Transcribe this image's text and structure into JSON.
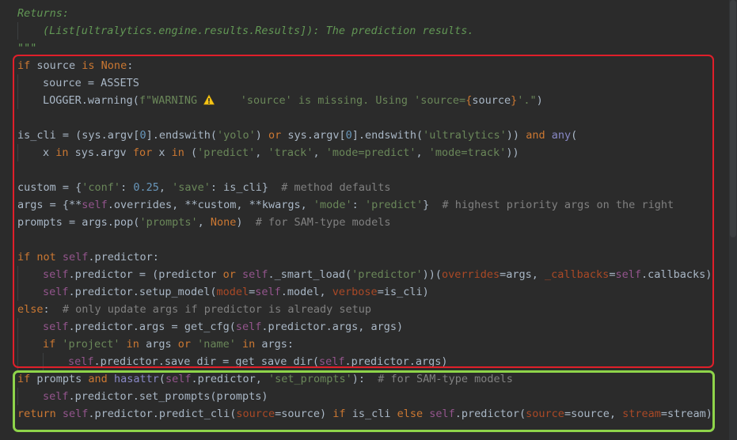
{
  "editor": {
    "lines": [
      {
        "indent": 0,
        "tokens": [
          {
            "t": "Returns:",
            "c": "doc"
          }
        ]
      },
      {
        "indent": 1,
        "tokens": [
          {
            "t": "(List[ultralytics.engine.results.Results]): The prediction results.",
            "c": "doc"
          }
        ]
      },
      {
        "indent": 0,
        "tokens": [
          {
            "t": "\"\"\"",
            "c": "doc"
          }
        ]
      },
      {
        "indent": 0,
        "tokens": [
          {
            "t": "if ",
            "c": "kw"
          },
          {
            "t": "source ",
            "c": "plain"
          },
          {
            "t": "is None",
            "c": "kw"
          },
          {
            "t": ":",
            "c": "plain"
          }
        ]
      },
      {
        "indent": 1,
        "tokens": [
          {
            "t": "source = ASSETS",
            "c": "plain"
          }
        ]
      },
      {
        "indent": 1,
        "tokens": [
          {
            "t": "LOGGER.warning(",
            "c": "plain"
          },
          {
            "t": "f\"WARNING ",
            "c": "str"
          },
          {
            "t": "warning-icon",
            "c": "icon"
          },
          {
            "t": "    'source' is missing. Using 'source=",
            "c": "str"
          },
          {
            "t": "{",
            "c": "kw"
          },
          {
            "t": "source",
            "c": "plain"
          },
          {
            "t": "}",
            "c": "kw"
          },
          {
            "t": "'.\"",
            "c": "str"
          },
          {
            "t": ")",
            "c": "plain"
          }
        ]
      },
      {
        "indent": 0,
        "tokens": []
      },
      {
        "indent": 0,
        "tokens": [
          {
            "t": "is_cli = (sys.argv[",
            "c": "plain"
          },
          {
            "t": "0",
            "c": "num"
          },
          {
            "t": "].endswith(",
            "c": "plain"
          },
          {
            "t": "'yolo'",
            "c": "str"
          },
          {
            "t": ") ",
            "c": "plain"
          },
          {
            "t": "or ",
            "c": "kw"
          },
          {
            "t": "sys.argv[",
            "c": "plain"
          },
          {
            "t": "0",
            "c": "num"
          },
          {
            "t": "].endswith(",
            "c": "plain"
          },
          {
            "t": "'ultralytics'",
            "c": "str"
          },
          {
            "t": ")) ",
            "c": "plain"
          },
          {
            "t": "and ",
            "c": "kw"
          },
          {
            "t": "any",
            "c": "builtin"
          },
          {
            "t": "(",
            "c": "plain"
          }
        ]
      },
      {
        "indent": 1,
        "tokens": [
          {
            "t": "x ",
            "c": "plain"
          },
          {
            "t": "in ",
            "c": "kw"
          },
          {
            "t": "sys.argv ",
            "c": "plain"
          },
          {
            "t": "for ",
            "c": "kw"
          },
          {
            "t": "x ",
            "c": "plain"
          },
          {
            "t": "in ",
            "c": "kw"
          },
          {
            "t": "(",
            "c": "plain"
          },
          {
            "t": "'predict'",
            "c": "str"
          },
          {
            "t": ", ",
            "c": "plain"
          },
          {
            "t": "'track'",
            "c": "str"
          },
          {
            "t": ", ",
            "c": "plain"
          },
          {
            "t": "'mode=predict'",
            "c": "str"
          },
          {
            "t": ", ",
            "c": "plain"
          },
          {
            "t": "'mode=track'",
            "c": "str"
          },
          {
            "t": "))",
            "c": "plain"
          }
        ]
      },
      {
        "indent": 0,
        "tokens": []
      },
      {
        "indent": 0,
        "tokens": [
          {
            "t": "custom = {",
            "c": "plain"
          },
          {
            "t": "'conf'",
            "c": "str"
          },
          {
            "t": ": ",
            "c": "plain"
          },
          {
            "t": "0.25",
            "c": "num"
          },
          {
            "t": ", ",
            "c": "plain"
          },
          {
            "t": "'save'",
            "c": "str"
          },
          {
            "t": ": is_cli}  ",
            "c": "plain"
          },
          {
            "t": "# method defaults",
            "c": "cm"
          }
        ]
      },
      {
        "indent": 0,
        "tokens": [
          {
            "t": "args = {**",
            "c": "plain"
          },
          {
            "t": "self",
            "c": "self"
          },
          {
            "t": ".overrides, **custom, **kwargs, ",
            "c": "plain"
          },
          {
            "t": "'mode'",
            "c": "str"
          },
          {
            "t": ": ",
            "c": "plain"
          },
          {
            "t": "'predict'",
            "c": "str"
          },
          {
            "t": "}  ",
            "c": "plain"
          },
          {
            "t": "# highest priority args on the right",
            "c": "cm"
          }
        ]
      },
      {
        "indent": 0,
        "tokens": [
          {
            "t": "prompts = args.pop(",
            "c": "plain"
          },
          {
            "t": "'prompts'",
            "c": "str"
          },
          {
            "t": ", ",
            "c": "plain"
          },
          {
            "t": "None",
            "c": "kw"
          },
          {
            "t": ")  ",
            "c": "plain"
          },
          {
            "t": "# for SAM-type models",
            "c": "cm"
          }
        ]
      },
      {
        "indent": 0,
        "tokens": []
      },
      {
        "indent": 0,
        "tokens": [
          {
            "t": "if not ",
            "c": "kw"
          },
          {
            "t": "self",
            "c": "self"
          },
          {
            "t": ".predictor:",
            "c": "plain"
          }
        ]
      },
      {
        "indent": 1,
        "tokens": [
          {
            "t": "self",
            "c": "self"
          },
          {
            "t": ".predictor = (predictor ",
            "c": "plain"
          },
          {
            "t": "or ",
            "c": "kw"
          },
          {
            "t": "self",
            "c": "self"
          },
          {
            "t": "._smart_load(",
            "c": "plain"
          },
          {
            "t": "'predictor'",
            "c": "str"
          },
          {
            "t": "))(",
            "c": "plain"
          },
          {
            "t": "overrides",
            "c": "param"
          },
          {
            "t": "=args, ",
            "c": "plain"
          },
          {
            "t": "_callbacks",
            "c": "param"
          },
          {
            "t": "=",
            "c": "plain"
          },
          {
            "t": "self",
            "c": "self"
          },
          {
            "t": ".callbacks)",
            "c": "plain"
          }
        ]
      },
      {
        "indent": 1,
        "tokens": [
          {
            "t": "self",
            "c": "self"
          },
          {
            "t": ".predictor.setup_model(",
            "c": "plain"
          },
          {
            "t": "model",
            "c": "param"
          },
          {
            "t": "=",
            "c": "plain"
          },
          {
            "t": "self",
            "c": "self"
          },
          {
            "t": ".model, ",
            "c": "plain"
          },
          {
            "t": "verbose",
            "c": "param"
          },
          {
            "t": "=is_cli)",
            "c": "plain"
          }
        ]
      },
      {
        "indent": 0,
        "tokens": [
          {
            "t": "else",
            "c": "kw"
          },
          {
            "t": ":  ",
            "c": "plain"
          },
          {
            "t": "# only update args if predictor is already setup",
            "c": "cm"
          }
        ]
      },
      {
        "indent": 1,
        "tokens": [
          {
            "t": "self",
            "c": "self"
          },
          {
            "t": ".predictor.args = get_cfg(",
            "c": "plain"
          },
          {
            "t": "self",
            "c": "self"
          },
          {
            "t": ".predictor.args, args)",
            "c": "plain"
          }
        ]
      },
      {
        "indent": 1,
        "tokens": [
          {
            "t": "if ",
            "c": "kw"
          },
          {
            "t": "'project' ",
            "c": "str"
          },
          {
            "t": "in ",
            "c": "kw"
          },
          {
            "t": "args ",
            "c": "plain"
          },
          {
            "t": "or ",
            "c": "kw"
          },
          {
            "t": "'name' ",
            "c": "str"
          },
          {
            "t": "in ",
            "c": "kw"
          },
          {
            "t": "args:",
            "c": "plain"
          }
        ]
      },
      {
        "indent": 2,
        "tokens": [
          {
            "t": "self",
            "c": "self"
          },
          {
            "t": ".predictor.save_dir = get_save_dir(",
            "c": "plain"
          },
          {
            "t": "self",
            "c": "self"
          },
          {
            "t": ".predictor.args)",
            "c": "plain"
          }
        ]
      },
      {
        "indent": 0,
        "tokens": [
          {
            "t": "if ",
            "c": "kw"
          },
          {
            "t": "prompts ",
            "c": "plain"
          },
          {
            "t": "and ",
            "c": "kw"
          },
          {
            "t": "hasattr",
            "c": "builtin"
          },
          {
            "t": "(",
            "c": "plain"
          },
          {
            "t": "self",
            "c": "self"
          },
          {
            "t": ".predictor, ",
            "c": "plain"
          },
          {
            "t": "'set_prompts'",
            "c": "str"
          },
          {
            "t": "):  ",
            "c": "plain"
          },
          {
            "t": "# for SAM-type models",
            "c": "cm"
          }
        ]
      },
      {
        "indent": 1,
        "tokens": [
          {
            "t": "self",
            "c": "self"
          },
          {
            "t": ".predictor.set_prompts(prompts)",
            "c": "plain"
          }
        ]
      },
      {
        "indent": 0,
        "tokens": [
          {
            "t": "return ",
            "c": "kw"
          },
          {
            "t": "self",
            "c": "self"
          },
          {
            "t": ".predictor.predict_cli(",
            "c": "plain"
          },
          {
            "t": "source",
            "c": "param"
          },
          {
            "t": "=source) ",
            "c": "plain"
          },
          {
            "t": "if ",
            "c": "kw"
          },
          {
            "t": "is_cli ",
            "c": "plain"
          },
          {
            "t": "else ",
            "c": "kw"
          },
          {
            "t": "self",
            "c": "self"
          },
          {
            "t": ".predictor(",
            "c": "plain"
          },
          {
            "t": "source",
            "c": "param"
          },
          {
            "t": "=source, ",
            "c": "plain"
          },
          {
            "t": "stream",
            "c": "param"
          },
          {
            "t": "=stream)",
            "c": "plain"
          }
        ]
      }
    ]
  },
  "highlights": {
    "red_color": "#e01f2a",
    "green_color": "#8ed44a"
  },
  "colors": {
    "background": "#2b2b2b",
    "keyword": "#cc7832",
    "string": "#6a8759",
    "docstring": "#629755",
    "number": "#6897bb",
    "self": "#94558d",
    "param": "#aa4926",
    "comment": "#808080",
    "text": "#a9b7c6"
  }
}
